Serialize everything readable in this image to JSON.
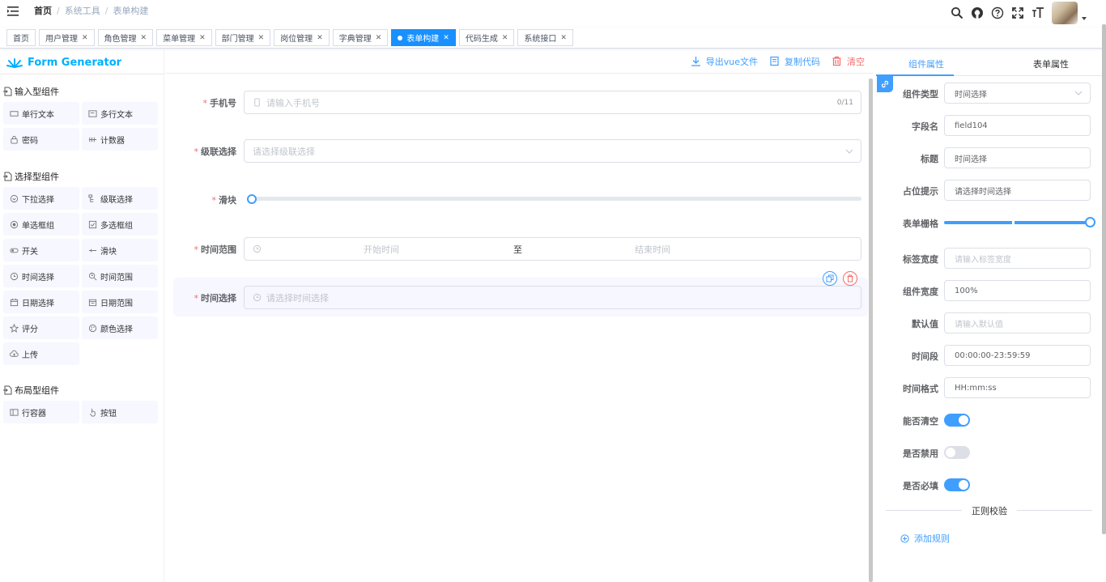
{
  "navbar": {
    "breadcrumb": [
      "首页",
      "系统工具",
      "表单构建"
    ],
    "icons": [
      "search-icon",
      "github-icon",
      "question-icon",
      "fullscreen-icon",
      "font-size-icon"
    ]
  },
  "tags": [
    {
      "label": "首页",
      "closable": false,
      "active": false
    },
    {
      "label": "用户管理",
      "closable": true,
      "active": false
    },
    {
      "label": "角色管理",
      "closable": true,
      "active": false
    },
    {
      "label": "菜单管理",
      "closable": true,
      "active": false
    },
    {
      "label": "部门管理",
      "closable": true,
      "active": false
    },
    {
      "label": "岗位管理",
      "closable": true,
      "active": false
    },
    {
      "label": "字典管理",
      "closable": true,
      "active": false
    },
    {
      "label": "表单构建",
      "closable": true,
      "active": true
    },
    {
      "label": "代码生成",
      "closable": true,
      "active": false
    },
    {
      "label": "系统接口",
      "closable": true,
      "active": false
    }
  ],
  "left": {
    "logo": "Form Generator",
    "groups": [
      {
        "title": "输入型组件",
        "items": [
          "单行文本",
          "多行文本",
          "密码",
          "计数器"
        ]
      },
      {
        "title": "选择型组件",
        "items": [
          "下拉选择",
          "级联选择",
          "单选框组",
          "多选框组",
          "开关",
          "滑块",
          "时间选择",
          "时间范围",
          "日期选择",
          "日期范围",
          "评分",
          "颜色选择",
          "上传"
        ]
      },
      {
        "title": "布局型组件",
        "items": [
          "行容器",
          "按钮"
        ]
      }
    ]
  },
  "center": {
    "actions": {
      "export": "导出vue文件",
      "copy": "复制代码",
      "clear": "清空"
    },
    "fields": [
      {
        "label": "手机号",
        "placeholder": "请输入手机号",
        "suffix": "0/11"
      },
      {
        "label": "级联选择",
        "placeholder": "请选择级联选择"
      },
      {
        "label": "滑块",
        "value": 0
      },
      {
        "label": "时间范围",
        "start": "开始时间",
        "sep": "至",
        "end": "结束时间"
      },
      {
        "label": "时间选择",
        "placeholder": "请选择时间选择"
      }
    ]
  },
  "right": {
    "tabs": [
      "组件属性",
      "表单属性"
    ],
    "props": {
      "type_label": "组件类型",
      "type_value": "时间选择",
      "field_label": "字段名",
      "field_value": "field104",
      "title_label": "标题",
      "title_value": "时间选择",
      "placeholder_label": "占位提示",
      "placeholder_value": "请选择时间选择",
      "grid_label": "表单栅格",
      "grid_value": 24,
      "label_width_label": "标签宽度",
      "label_width_placeholder": "请输入标签宽度",
      "width_label": "组件宽度",
      "width_value": "100%",
      "default_label": "默认值",
      "default_placeholder": "请输入默认值",
      "range_label": "时间段",
      "range_value": "00:00:00-23:59:59",
      "format_label": "时间格式",
      "format_value": "HH:mm:ss",
      "clearable_label": "能否清空",
      "clearable": true,
      "disabled_label": "是否禁用",
      "disabled": false,
      "required_label": "是否必填",
      "required": true,
      "regex_title": "正则校验",
      "add_rule": "添加规则"
    }
  },
  "colors": {
    "primary": "#409eff",
    "tag_active": "#1890ff",
    "danger": "#f56c6c",
    "logo": "#00afff"
  }
}
